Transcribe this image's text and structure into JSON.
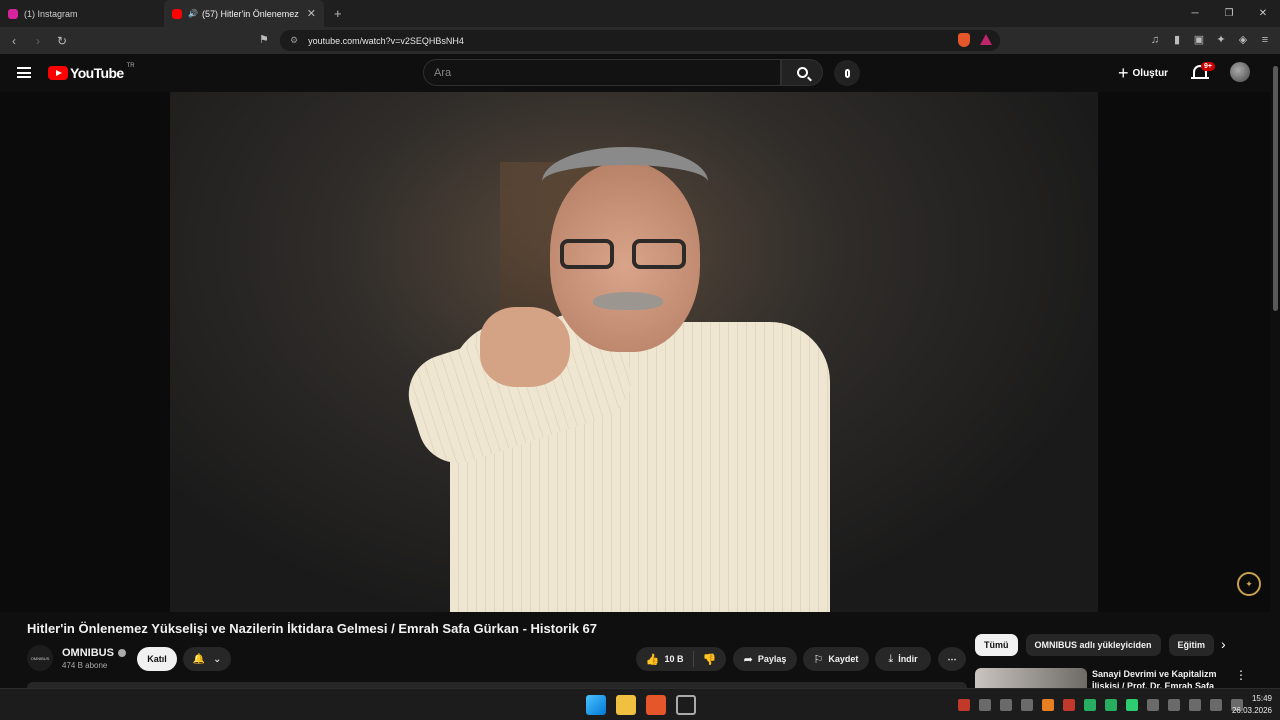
{
  "browser": {
    "tabs": [
      {
        "title": "(1) Instagram",
        "icon": "instagram-icon",
        "color": "#d6249f"
      },
      {
        "title": "(57) Hitler'in Önlenemez Yükseli",
        "icon": "youtube-icon",
        "color": "#ff0000"
      }
    ],
    "url": "youtube.com/watch?v=v2SEQHBsNH4"
  },
  "header": {
    "logo_text": "YouTube",
    "country_code": "TR",
    "search_placeholder": "Ara",
    "create_label": "Oluştur",
    "notifications_badge": "9+"
  },
  "video": {
    "title": "Hitler'in Önlenemez Yükselişi ve Nazilerin İktidara Gelmesi / Emrah Safa Gürkan - Historik 67"
  },
  "channel": {
    "name": "OMNIBUS",
    "avatar_text": "OMNIBUS",
    "subscribers": "474 B abone",
    "join_label": "Katıl"
  },
  "actions": {
    "likes": "10 B",
    "share": "Paylaş",
    "save": "Kaydet",
    "download": "İndir"
  },
  "chips": [
    "Tümü",
    "OMNIBUS adlı yükleyiciden",
    "Eğitim"
  ],
  "recommendation": {
    "title": "Sanayi Devrimi ve Kapitalizm İlişkisi / Prof. Dr. Emrah Safa"
  },
  "taskbar": {
    "time": "15:49",
    "date": "26.03.2026"
  }
}
